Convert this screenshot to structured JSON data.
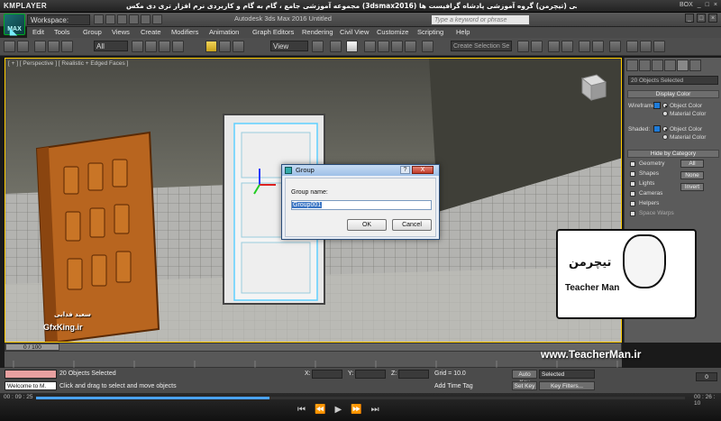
{
  "player": {
    "logo": "KMPLAYER",
    "title": "مجموعه آموزشی جامع ، گام به گام و کاربردی نرم افزار تری دی مکس (3dsmax2016) مدرس : سعید فدایی (تیچرمن) گروه آموزشی پادشاه گرافیست ها",
    "right_controls": [
      "BOX",
      "_",
      "□",
      "×"
    ],
    "time_current": "00 : 09 : 25",
    "time_total": "00 : 26 : 10",
    "progress": 0.36,
    "controls": [
      "⏮",
      "⏪",
      "▶",
      "⏩",
      "⏭"
    ]
  },
  "max": {
    "logo_text": "MAX",
    "workspace": "Workspace: Default",
    "app_title": "Autodesk 3ds Max 2016    Untitled",
    "search_placeholder": "Type a keyword or phrase",
    "window_controls": [
      "_",
      "□",
      "×"
    ]
  },
  "menu": [
    "Edit",
    "Tools",
    "Group",
    "Views",
    "Create",
    "Modifiers",
    "Animation",
    "Graph Editors",
    "Rendering",
    "Civil View",
    "Customize",
    "Scripting",
    "Help"
  ],
  "toolbar": {
    "filter": "All",
    "ref_coord": "View",
    "named_selection": "Create Selection Se"
  },
  "viewport": {
    "label": "[ + ] [ Perspective ] [ Realistic + Edged Faces ]"
  },
  "command_panel": {
    "object_name": "20 Objects Selected",
    "display_color_title": "Display Color",
    "wireframe_label": "Wireframe:",
    "shaded_label": "Shaded:",
    "object_color": "Object Color",
    "material_color": "Material Color",
    "hide_by_category": "Hide by Category",
    "categories": [
      "Geometry",
      "Shapes",
      "Lights",
      "Cameras",
      "Helpers",
      "Space Warps"
    ],
    "btn_all": "All",
    "btn_none": "None",
    "btn_invert": "Invert",
    "swatch_color": "#1e7bd8"
  },
  "dialog": {
    "title": "Group",
    "help": "?",
    "close": "X",
    "label": "Group name:",
    "value": "Group001",
    "ok": "OK",
    "cancel": "Cancel"
  },
  "watermark": {
    "brand": "Teacher Man",
    "brand_fa": "تیچرمن",
    "url": "www.TeacherMan.ir",
    "gfx": "GfxKing.ir",
    "gfx_fa": "سعید فدایی"
  },
  "timeline": {
    "slider": "0 / 100"
  },
  "status": {
    "welcome": "Welcome to M.",
    "selection": "20 Objects Selected",
    "prompt": "Click and drag to select and move objects",
    "x_label": "X:",
    "y_label": "Y:",
    "z_label": "Z:",
    "grid": "Grid = 10.0",
    "add_time_tag": "Add Time Tag",
    "auto_key": "Auto Key",
    "set_key": "Set Key",
    "selected": "Selected",
    "key_filters": "Key Filters...",
    "frame": "0"
  }
}
